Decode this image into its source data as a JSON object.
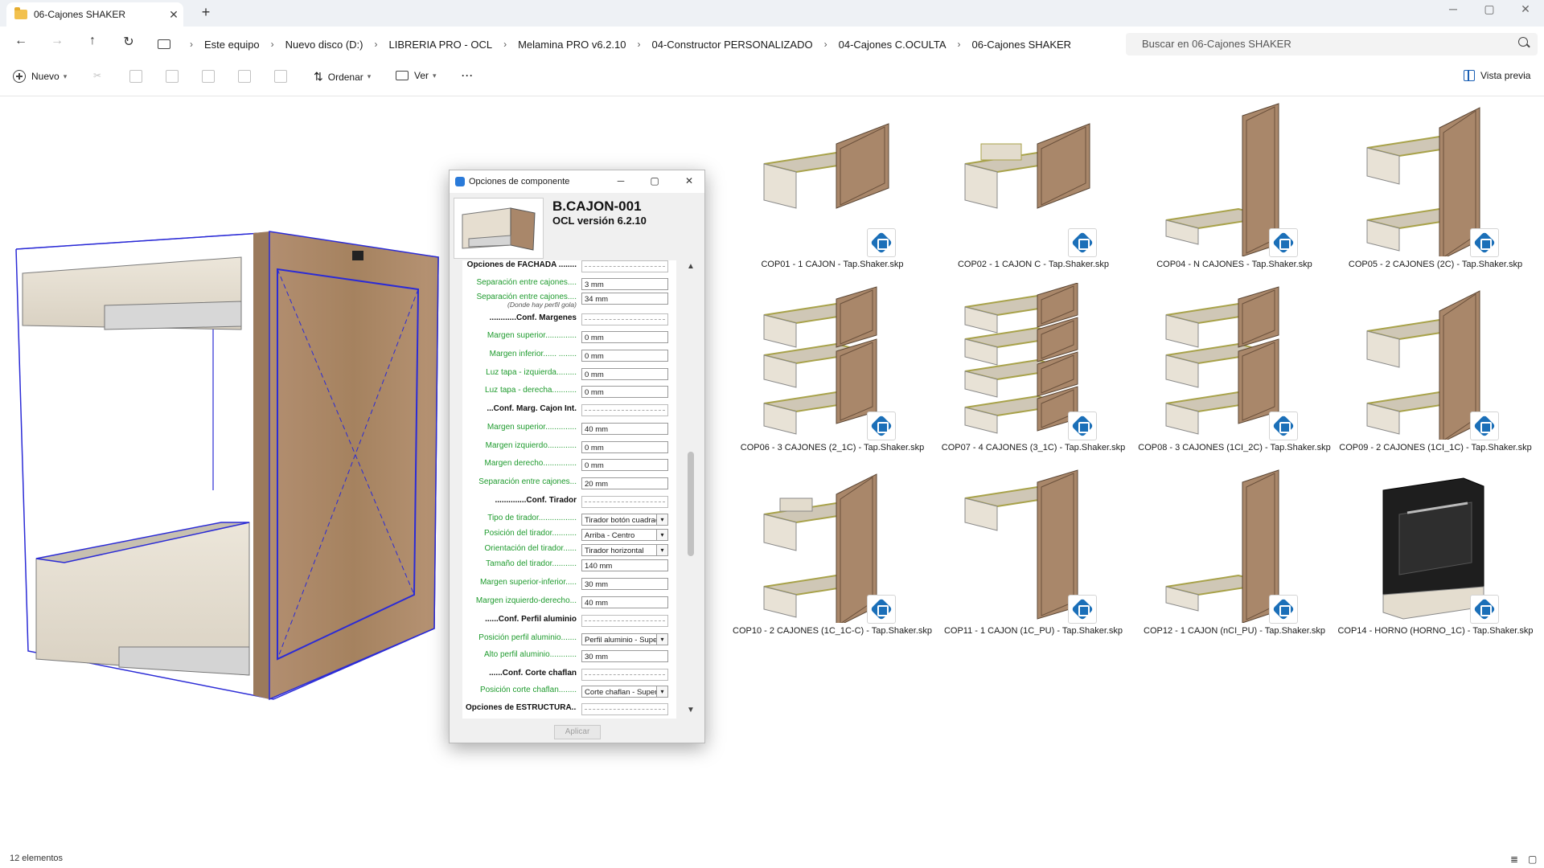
{
  "tab": {
    "title": "06-Cajones SHAKER",
    "close": "✕",
    "new": "+"
  },
  "window": {
    "minimize": "─",
    "maximize": "▢",
    "close": "✕"
  },
  "nav": {
    "back": "←",
    "forward": "→",
    "up": "↑",
    "refresh": "↻"
  },
  "breadcrumbs": [
    "Este equipo",
    "Nuevo disco (D:)",
    "LIBRERIA PRO - OCL",
    "Melamina PRO v6.2.10",
    "04-Constructor PERSONALIZADO",
    "04-Cajones C.OCULTA",
    "06-Cajones SHAKER"
  ],
  "breadcrumb_sep": "›",
  "search": {
    "placeholder": "Buscar en 06-Cajones SHAKER"
  },
  "toolbar": {
    "new": "Nuevo",
    "sort": "Ordenar",
    "view": "Ver",
    "more": "···",
    "preview": "Vista previa"
  },
  "dialog": {
    "title": "Opciones de componente",
    "component_name": "B.CAJON-001",
    "version": "OCL versión 6.2.10",
    "apply": "Aplicar",
    "rows": [
      {
        "label": "Opciones de FACHADA ........",
        "header": true,
        "value": ""
      },
      {
        "label": "Separación entre cajones....",
        "value": "3 mm"
      },
      {
        "label": "Separación entre cajones....",
        "note": "(Donde hay perfil gola)",
        "value": "34 mm"
      },
      {
        "label": "............Conf. Margenes",
        "header": true,
        "value": ""
      },
      {
        "label": "Margen superior..............",
        "value": "0 mm"
      },
      {
        "label": "Margen inferior...... ........",
        "value": "0 mm"
      },
      {
        "label": "Luz tapa - izquierda.........",
        "value": "0 mm"
      },
      {
        "label": "Luz tapa - derecha...........",
        "value": "0 mm"
      },
      {
        "label": "...Conf. Marg. Cajon Int.",
        "header": true,
        "value": ""
      },
      {
        "label": "Margen superior..............",
        "value": "40 mm"
      },
      {
        "label": "Margen izquierdo.............",
        "value": "0 mm"
      },
      {
        "label": "Margen derecho...............",
        "value": "0 mm"
      },
      {
        "label": "Separación entre cajones...",
        "value": "20 mm"
      },
      {
        "label": "..............Conf. Tirador",
        "header": true,
        "value": ""
      },
      {
        "label": "Tipo de tirador.................",
        "value": "Tirador botón cuadrado",
        "select": true
      },
      {
        "label": "Posición del tirador...........",
        "value": "Arriba - Centro",
        "select": true
      },
      {
        "label": "Orientación del tirador......",
        "value": "Tirador horizontal",
        "select": true
      },
      {
        "label": "Tamaño del tirador...........",
        "value": "140 mm"
      },
      {
        "label": "Margen superior-inferior.....",
        "value": "30 mm"
      },
      {
        "label": "Margen izquierdo-derecho...",
        "value": "40 mm"
      },
      {
        "label": "......Conf. Perfil aluminio",
        "header": true,
        "value": ""
      },
      {
        "label": "Posición perfil aluminio.......",
        "value": "Perfil aluminio - Superior",
        "select": true
      },
      {
        "label": "Alto perfil aluminio............",
        "value": "30 mm"
      },
      {
        "label": "......Conf. Corte chaflan",
        "header": true,
        "value": ""
      },
      {
        "label": "Posición corte chaflan........",
        "value": "Corte chaflan - Superior",
        "select": true
      },
      {
        "label": "Opciones de ESTRUCTURA...",
        "header": true,
        "value": ""
      }
    ]
  },
  "files": [
    {
      "name": "COP01 - 1 CAJON - Tap.Shaker.skp",
      "thumb": "one-drawer"
    },
    {
      "name": "COP02 - 1 CAJON C - Tap.Shaker.skp",
      "thumb": "one-drawer-inner"
    },
    {
      "name": "COP04 - N CAJONES - Tap.Shaker.skp",
      "thumb": "tall-front"
    },
    {
      "name": "COP05 - 2 CAJONES (2C) - Tap.Shaker.skp",
      "thumb": "two-drawers"
    },
    {
      "name": "COP06 - 3 CAJONES (2_1C) - Tap.Shaker.skp",
      "thumb": "three-drawers"
    },
    {
      "name": "COP07 - 4 CAJONES (3_1C) - Tap.Shaker.skp",
      "thumb": "four-drawers"
    },
    {
      "name": "COP08 - 3 CAJONES (1CI_2C) - Tap.Shaker.skp",
      "thumb": "three-drawers"
    },
    {
      "name": "COP09 - 2 CAJONES (1CI_1C) - Tap.Shaker.skp",
      "thumb": "two-drawers"
    },
    {
      "name": "COP10 - 2 CAJONES (1C_1C-C) - Tap.Shaker.skp",
      "thumb": "two-drawers-inner"
    },
    {
      "name": "COP11 - 1 CAJON (1C_PU) - Tap.Shaker.skp",
      "thumb": "drawer-door"
    },
    {
      "name": "COP12 - 1 CAJON (nCI_PU) - Tap.Shaker.skp",
      "thumb": "tall-front"
    },
    {
      "name": "COP14 - HORNO (HORNO_1C) - Tap.Shaker.skp",
      "thumb": "oven"
    }
  ],
  "status": {
    "count": "12 elementos",
    "details_view": "≣",
    "tiles_view": "▢"
  },
  "colors": {
    "accent": "#1a5fb4",
    "label_green": "#1f9b2e",
    "wood": "#a9876a",
    "sketchup_blue": "#1b6fb8"
  }
}
